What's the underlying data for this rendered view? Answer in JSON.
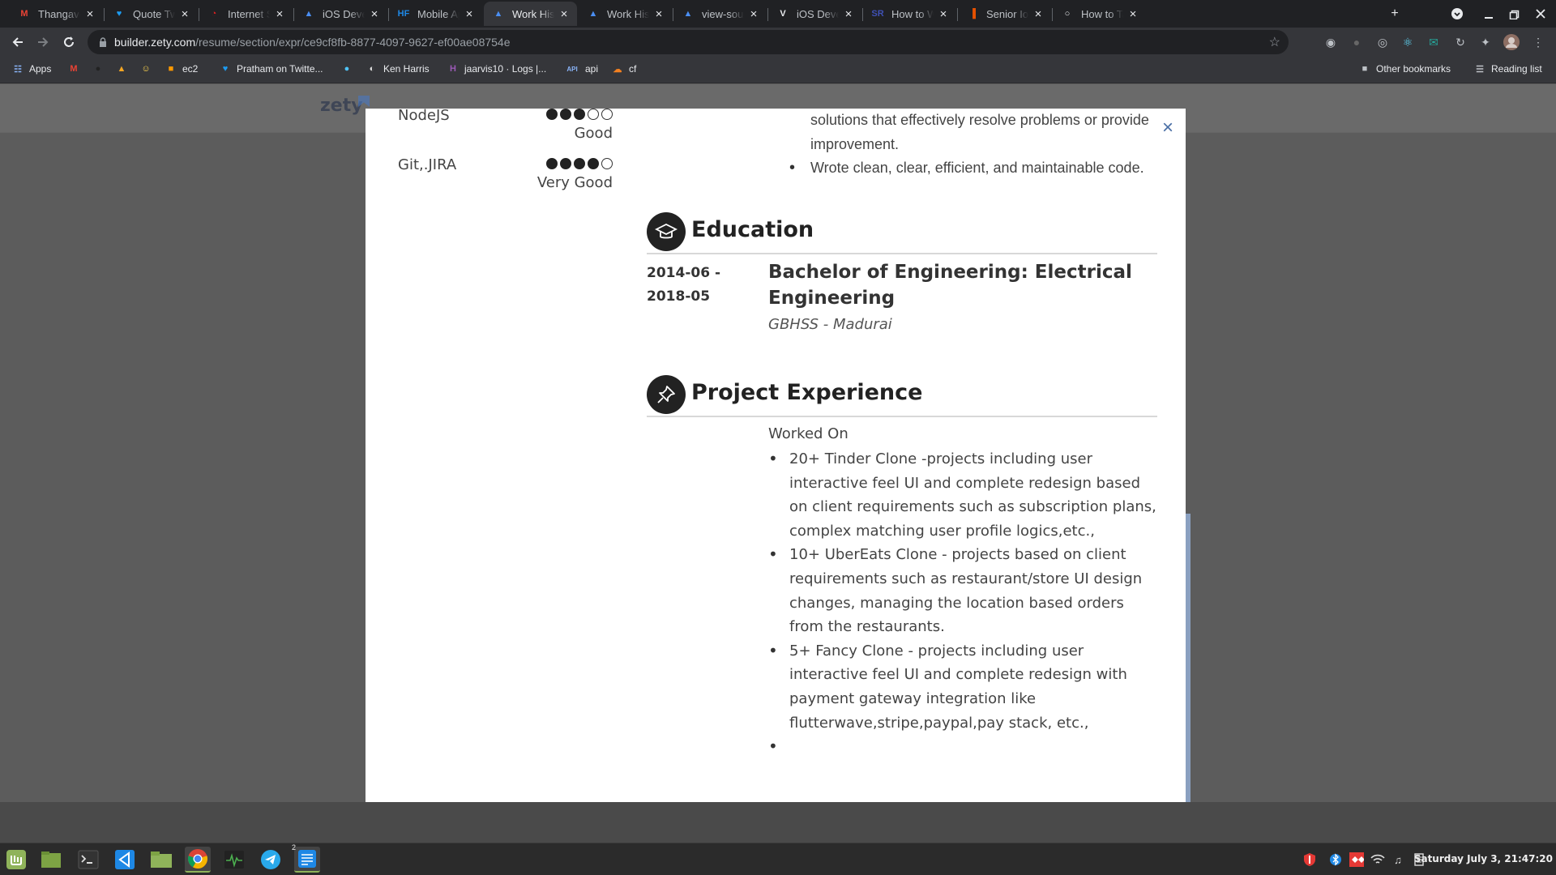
{
  "browser": {
    "tabs": [
      {
        "title": "Thangavel | F",
        "icon": "gmail-icon",
        "color": "#ea4335",
        "glyph": "M"
      },
      {
        "title": "Quote Tweets",
        "icon": "twitter-icon",
        "color": "#1d9bf0",
        "glyph": "♥"
      },
      {
        "title": "Internet Spee",
        "icon": "speedtest-icon",
        "color": "#e02020",
        "glyph": "◔"
      },
      {
        "title": "iOS Develope",
        "icon": "zety-icon",
        "color": "#4a8ef2",
        "glyph": "▲"
      },
      {
        "title": "Mobile Applic",
        "icon": "hf-icon",
        "color": "#1e88e5",
        "glyph": "HF"
      },
      {
        "title": "Work History",
        "icon": "zety-icon",
        "color": "#4a8ef2",
        "glyph": "▲",
        "active": true
      },
      {
        "title": "Work History",
        "icon": "zety-icon",
        "color": "#4a8ef2",
        "glyph": "▲"
      },
      {
        "title": "view-source:h",
        "icon": "zety-icon",
        "color": "#4a8ef2",
        "glyph": "▲"
      },
      {
        "title": "iOS Develope",
        "icon": "v-icon",
        "color": "#e8eaed",
        "glyph": "V"
      },
      {
        "title": "How to Write",
        "icon": "sr-icon",
        "color": "#3f51b5",
        "glyph": "SR"
      },
      {
        "title": "Senior Ios De",
        "icon": "bars-icon",
        "color": "#e65100",
        "glyph": "▐"
      },
      {
        "title": "How to Take S",
        "icon": "globe-icon",
        "color": "#e8eaed",
        "glyph": "○"
      }
    ],
    "new_tab": "+",
    "url_host": "builder.zety.com",
    "url_path": "/resume/section/expr/ce9cf8fb-8877-4097-9627-ef00ae08754e",
    "bookmarks": [
      {
        "label": "Apps",
        "icon": "apps-grid-icon",
        "color": "#8ab4f8",
        "glyph": "☷"
      },
      {
        "label": "",
        "icon": "gmail-icon",
        "color": "#ea4335",
        "glyph": "M"
      },
      {
        "label": "",
        "icon": "github-icon",
        "color": "#222",
        "glyph": "●"
      },
      {
        "label": "",
        "icon": "ubuntu-icon",
        "color": "#f5a623",
        "glyph": "▲"
      },
      {
        "label": "",
        "icon": "smiley-icon",
        "color": "#ffd54f",
        "glyph": "☺"
      },
      {
        "label": "ec2",
        "icon": "aws-icon",
        "color": "#ff9900",
        "glyph": "■"
      },
      {
        "label": "Pratham on Twitte...",
        "icon": "twitter-icon",
        "color": "#1d9bf0",
        "glyph": "♥"
      },
      {
        "label": "",
        "icon": "circle-icon",
        "color": "#4fc3f7",
        "glyph": "●"
      },
      {
        "label": "Ken Harris",
        "icon": "ken-icon",
        "color": "#e0e0e0",
        "glyph": "◐"
      },
      {
        "label": "jaarvis10 · Logs |...",
        "icon": "heroku-icon",
        "color": "#9b59b6",
        "glyph": "H"
      },
      {
        "label": "api",
        "icon": "api-icon",
        "color": "#8ab4f8",
        "glyph": "API"
      },
      {
        "label": "cf",
        "icon": "cloudflare-icon",
        "color": "#f38020",
        "glyph": "☁"
      }
    ],
    "other_bookmarks": "Other bookmarks",
    "reading_list": "Reading list"
  },
  "page": {
    "logo_text": "zety",
    "close_glyph": "×",
    "skills": [
      {
        "name": "NodeJS",
        "level": "Good",
        "rating": 3
      },
      {
        "name": "Git,.JIRA",
        "level": "Very Good",
        "rating": 4
      }
    ],
    "work_bullets_tail": [
      "solutions that effectively resolve problems or provide improvement.",
      "Wrote clean, clear, efficient, and maintainable code."
    ],
    "education": {
      "title": "Education",
      "date_start": "2014-06 -",
      "date_end": "2018-05",
      "degree": "Bachelor of Engineering: Electrical Engineering",
      "school": "GBHSS - Madurai"
    },
    "projects": {
      "title": "Project Experience",
      "heading": "Worked On",
      "items": [
        "20+ Tinder Clone -projects including user interactive feel UI and complete redesign based on client requirements such as subscription plans, complex matching user profile logics,etc.,",
        "10+ UberEats Clone - projects based on client requirements such as restaurant/store UI design changes, managing the location based orders from the restaurants.",
        "5+ Fancy Clone - projects including user interactive feel UI and complete redesign with payment gateway integration like flutterwave,stripe,paypal,pay stack, etc.,",
        ""
      ]
    }
  },
  "taskbar": {
    "clock": "Saturday July  3, 21:47:20",
    "badge": "2"
  }
}
